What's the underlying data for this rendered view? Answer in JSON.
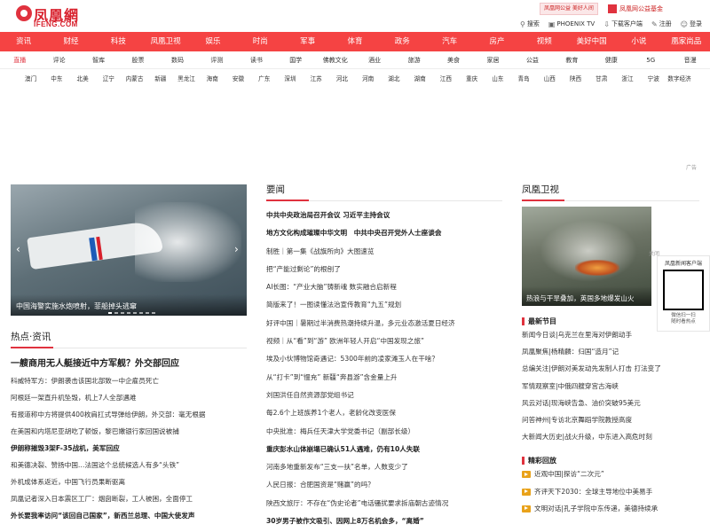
{
  "brand": {
    "name_cn": "凤凰網",
    "name_en": "IFENG.COM"
  },
  "header": {
    "promo1": "凤凰网公益 美好人间",
    "promo2": "凤凰网公益基金",
    "toolbar": [
      {
        "icon": "search-icon",
        "glyph": "⚲",
        "label": "搜索"
      },
      {
        "icon": "tv-icon",
        "glyph": "▣",
        "label": "PHOENIX TV"
      },
      {
        "icon": "download-icon",
        "glyph": "⇩",
        "label": "下载客户端"
      },
      {
        "icon": "register-icon",
        "glyph": "✎",
        "label": "注册"
      },
      {
        "icon": "login-icon",
        "glyph": "☺",
        "label": "登录"
      }
    ]
  },
  "main_nav": [
    "资讯",
    "财经",
    "科技",
    "凤凰卫视",
    "娱乐",
    "时尚",
    "军事",
    "体育",
    "政务",
    "汽车",
    "房产",
    "视频",
    "美好中国",
    "小说",
    "凰家尚品"
  ],
  "sub_nav": [
    "直播",
    "评论",
    "智库",
    "股票",
    "数码",
    "评测",
    "读书",
    "国学",
    "佛教文化",
    "酒业",
    "旅游",
    "美食",
    "家居",
    "公益",
    "教育",
    "健康",
    "5G",
    "音漫"
  ],
  "region_nav": [
    "澳门",
    "中东",
    "北美",
    "辽宁",
    "内蒙古",
    "新疆",
    "黑龙江",
    "海南",
    "安徽",
    "广东",
    "深圳",
    "江苏",
    "河北",
    "河南",
    "湖北",
    "湖南",
    "江西",
    "重庆",
    "山东",
    "青岛",
    "山西",
    "陕西",
    "甘肃",
    "浙江",
    "宁波",
    "数字经济"
  ],
  "ad_label": "广告",
  "hero": {
    "caption": "中国海警实施水炮喷射，菲船掉头逃窜",
    "slides": 8,
    "active": 0
  },
  "hot": {
    "title": "热点·资讯",
    "lead": "一艘商用无人艇接近中方军舰？外交部回应",
    "items": [
      {
        "text": "科威特军方：伊朗袭击该国北部致一中企雇员死亡",
        "bold": false
      },
      {
        "text": "阿根廷一架直升机坠毁，机上7人全部遇难",
        "bold": false
      },
      {
        "text": "有报道称中方将提供400枚肩扛式导弹给伊朗，外交部：毫无根据",
        "bold": false
      },
      {
        "text": "在美国和内塔尼亚胡吃了顿饭，黎巴嫩银行家回国说被捕",
        "bold": false
      },
      {
        "text": "伊朗称摧毁3架F-35战机，美军回应",
        "bold": true
      },
      {
        "text": "和美德决裂、赞扬中国…法国这个总统候选人有多“头铁”",
        "bold": false
      },
      {
        "text": "外机成体系返近，中国飞行员果断驱离",
        "bold": false
      },
      {
        "text": "凤凰记者深入日本震区工厂：烟囱断裂，工人被困，全面停工",
        "bold": false
      },
      {
        "text": "外长要我率访问“该回自己国家”，新西兰总理、中国大使发声",
        "bold": true
      }
    ]
  },
  "news": {
    "title": "要闻",
    "items": [
      {
        "text": "中共中央政治局召开会议 习近平主持会议",
        "bold": true
      },
      {
        "text": "地方文化构成璀璨中华文明　中共中央召开党外人士座谈会",
        "bold": true
      },
      {
        "text": "制胜｜第一集《战旗所向》大图速览",
        "bold": false
      },
      {
        "text": "把“产能过剩论”的根刨了",
        "bold": false
      },
      {
        "text": "AI长图：“产业大脑”铸新魂 数实融合启新程",
        "bold": false
      },
      {
        "text": "简版来了！一图读懂法治宣传教育“九五”规划",
        "bold": false
      },
      {
        "text": "好评中国｜暑期过半消费热潮持续升温，多元业态激活夏日经济",
        "bold": false
      },
      {
        "text": "视频｜从“看”到“游” 欧洲年轻人开启“中国发现之旅”",
        "bold": false
      },
      {
        "text": "埃及小伙博物馆奇遇记：5300年前的凌家滩玉人在干啥？",
        "bold": false
      },
      {
        "text": "从“打卡”到“慢充” 新疆“奔县游”含金量上升",
        "bold": false
      },
      {
        "text": "刘国洪任自然资源部党组书记",
        "bold": false
      },
      {
        "text": "每2.6个上班族养1个老人，老龄化改变医保",
        "bold": false
      },
      {
        "text": "中央批准：梅兵任天津大学党委书记（副部长级）",
        "bold": false
      },
      {
        "text": "重庆彭水山体崩塌已确认51人遇难，仍有10人失联",
        "bold": true
      },
      {
        "text": "河南多地重新发布“三支一扶”名单，人数变少了",
        "bold": false
      },
      {
        "text": "人民日报：合肥国资是“赌赢”的吗？",
        "bold": false
      },
      {
        "text": "陕西文旅厅：不存在“伪史论者”电话骚扰要求拆庙朝古迹情况",
        "bold": false
      },
      {
        "text": "30岁男子被作文吸引、因网上8万名机会多，“离婚”",
        "bold": true
      }
    ]
  },
  "tv": {
    "title": "凤凰卫视",
    "caption": "热浪与干旱叠加，英国多地爆发山火",
    "newest_title": "最新节目",
    "newest": [
      "新闻今日谈|乌克兰在里海对伊朗动手",
      "凤凰聚焦|杨精麟：归国“造月”记",
      "总编关注|伊朗对美发动先发制人打击 打法变了",
      "军情观察室|中俄四艘穿宫古海峡",
      "风云对话|现海峡告急、油价突破95美元",
      "问答神州|专访北京舞蹈学院教授高度",
      "大新闻大历史|战火升级，中东进入高危时刻"
    ],
    "featured_title": "精彩回放",
    "featured": [
      "近观中国|探访“二次元”",
      "齐评天下2030：全球主导地位中美易手",
      "文明对话|孔子学院中东传递，美德持续承"
    ]
  },
  "qr": {
    "title": "凤凰新闻客户端",
    "line1": "微信扫一扫",
    "line2": "随时看热点",
    "close": "关闭"
  },
  "colors": {
    "brand_red": "#f54343",
    "accent": "#e0323e",
    "video_badge": "#e9a21a"
  }
}
